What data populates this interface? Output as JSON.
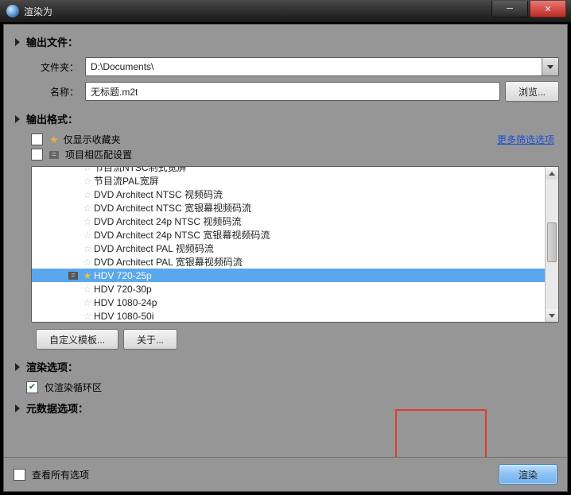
{
  "window": {
    "title": "渲染为"
  },
  "sections": {
    "output_file": "输出文件：",
    "output_format": "输出格式：",
    "render_options": "渲染选项：",
    "metadata_options": "元数据选项："
  },
  "output": {
    "folder_label": "文件夹：",
    "folder_value": "D:\\Documents\\",
    "name_label": "名称：",
    "name_value": "无标题.m2t",
    "browse_btn": "浏览..."
  },
  "format": {
    "show_fav_label": "仅显示收藏夹",
    "match_project_label": "项目相匹配设置",
    "more_filters": "更多筛选选项",
    "items": [
      {
        "label": "节目流NTSC制式宽屏",
        "fav": false,
        "selected": false
      },
      {
        "label": "节目流PAL宽屏",
        "fav": false,
        "selected": false
      },
      {
        "label": "DVD Architect NTSC 视频码流",
        "fav": false,
        "selected": false
      },
      {
        "label": "DVD Architect NTSC 宽银幕视频码流",
        "fav": false,
        "selected": false
      },
      {
        "label": "DVD Architect 24p NTSC 视频码流",
        "fav": false,
        "selected": false
      },
      {
        "label": "DVD Architect 24p NTSC 宽银幕视频码流",
        "fav": false,
        "selected": false
      },
      {
        "label": "DVD Architect PAL 视频码流",
        "fav": false,
        "selected": false
      },
      {
        "label": "DVD Architect PAL 宽银幕视频码流",
        "fav": false,
        "selected": false
      },
      {
        "label": "HDV 720-25p",
        "fav": true,
        "selected": true
      },
      {
        "label": "HDV 720-30p",
        "fav": false,
        "selected": false
      },
      {
        "label": "HDV 1080-24p",
        "fav": false,
        "selected": false
      },
      {
        "label": "HDV 1080-50i",
        "fav": false,
        "selected": false
      }
    ],
    "custom_template_btn": "自定义模板...",
    "about_btn": "关于..."
  },
  "render": {
    "loop_only_label": "仅渲染循环区"
  },
  "footer": {
    "show_all_label": "查看所有选项",
    "render_btn": "渲染"
  }
}
